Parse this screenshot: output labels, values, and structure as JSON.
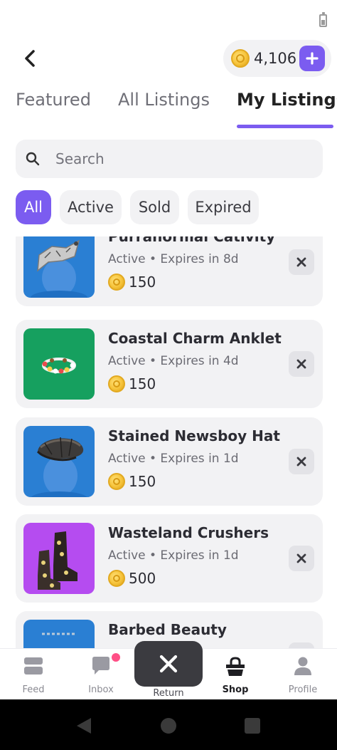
{
  "header": {
    "balance": "4,106"
  },
  "tabs": [
    {
      "label": "Featured"
    },
    {
      "label": "All Listings"
    },
    {
      "label": "My Listings"
    }
  ],
  "search": {
    "placeholder": "Search"
  },
  "filters": [
    {
      "label": "All"
    },
    {
      "label": "Active"
    },
    {
      "label": "Sold"
    },
    {
      "label": "Expired"
    }
  ],
  "listings": [
    {
      "name": "Purranormal Cativity",
      "status": "Active • Expires in 8d",
      "price": "150",
      "thumb_color": "#2a7fd3"
    },
    {
      "name": "Coastal Charm Anklet",
      "status": "Active • Expires in 4d",
      "price": "150",
      "thumb_color": "#16a05f"
    },
    {
      "name": "Stained Newsboy Hat",
      "status": "Active • Expires in 1d",
      "price": "150",
      "thumb_color": "#2a7fd3"
    },
    {
      "name": "Wasteland Crushers",
      "status": "Active • Expires in 1d",
      "price": "500",
      "thumb_color": "#b54cf0"
    },
    {
      "name": "Barbed Beauty",
      "status": "",
      "price": "",
      "thumb_color": "#2a7fd3"
    }
  ],
  "nav": {
    "feed": "Feed",
    "inbox": "Inbox",
    "return": "Return",
    "shop": "Shop",
    "profile": "Profile"
  },
  "colors": {
    "accent": "#7b5cf0",
    "card_bg": "#f2f2f4",
    "notification": "#ff4f86"
  }
}
